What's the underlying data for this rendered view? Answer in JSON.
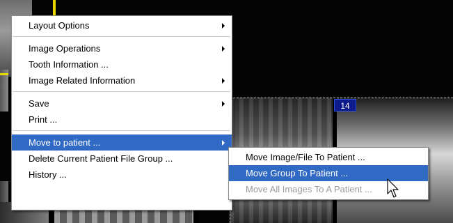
{
  "viewer": {
    "tooth_number": "14"
  },
  "context_menu": {
    "items": [
      {
        "label": "Layout Options",
        "submenu": true
      },
      {
        "label": "Image Operations",
        "submenu": true
      },
      {
        "label": "Tooth Information ...",
        "submenu": false
      },
      {
        "label": "Image Related Information",
        "submenu": true
      },
      {
        "label": "Save",
        "submenu": true
      },
      {
        "label": "Print ...",
        "submenu": false
      },
      {
        "label": "Move to patient ...",
        "submenu": true,
        "highlighted": true
      },
      {
        "label": "Delete Current Patient File Group ...",
        "submenu": false
      },
      {
        "label": "History ...",
        "submenu": false
      }
    ]
  },
  "submenu": {
    "items": [
      {
        "label": "Move Image/File To Patient ...",
        "enabled": true
      },
      {
        "label": "Move Group To Patient ...",
        "enabled": true,
        "highlighted": true
      },
      {
        "label": "Move All Images To A Patient ...",
        "enabled": false
      }
    ]
  },
  "colors": {
    "highlight": "#316ac5",
    "badge": "#0c1a8c",
    "frame_accent": "#e8d800",
    "disabled_text": "#9a9a9a"
  },
  "icons": {
    "submenu_arrow": "chevron-right-icon",
    "cursor": "mouse-pointer-icon"
  }
}
